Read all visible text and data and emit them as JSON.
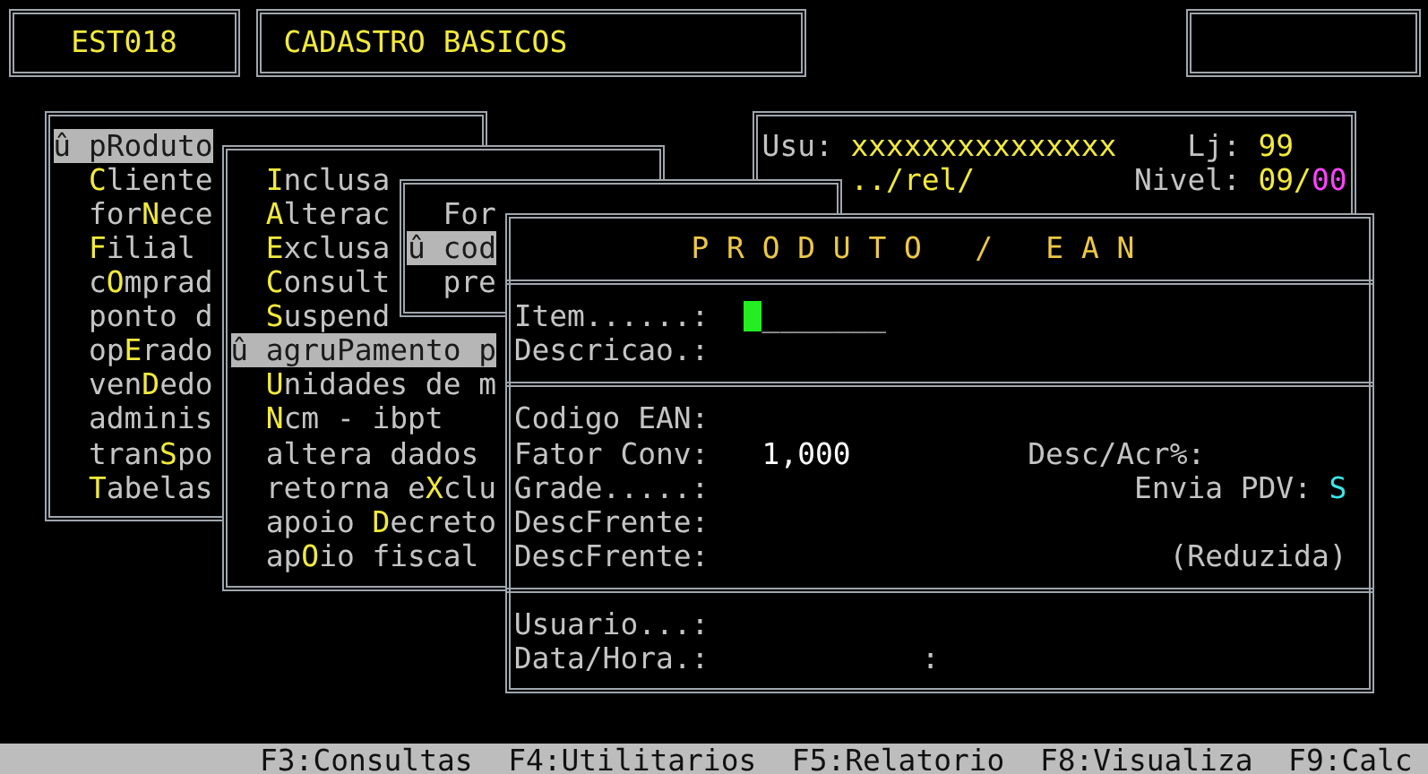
{
  "header": {
    "program_code": "EST018",
    "title": "CADASTRO BASICOS"
  },
  "main_menu": {
    "items": [
      {
        "label": "û p**R**oduto",
        "selected": true
      },
      {
        "label": "**C**liente",
        "selected": false
      },
      {
        "label": "for**N**ece",
        "selected": false
      },
      {
        "label": "**F**ilial",
        "selected": false
      },
      {
        "label": "c**O**mprad",
        "selected": false
      },
      {
        "label": "ponto d",
        "selected": false
      },
      {
        "label": "op**E**rado",
        "selected": false
      },
      {
        "label": "ven**D**edo",
        "selected": false
      },
      {
        "label": "adminis",
        "selected": false
      },
      {
        "label": "tran**S**po",
        "selected": false
      },
      {
        "label": "**T**abelas",
        "selected": false
      }
    ]
  },
  "submenu": {
    "items": [
      {
        "label": "**I**nclusa",
        "selected": false
      },
      {
        "label": "**A**lterac",
        "selected": false
      },
      {
        "label": "**E**xclusa",
        "selected": false
      },
      {
        "label": "**C**onsult",
        "selected": false
      },
      {
        "label": "**S**uspend",
        "selected": false
      },
      {
        "label": "û agru**P**amento p",
        "selected": true
      },
      {
        "label": "**U**nidades de m",
        "selected": false
      },
      {
        "label": "**N**cm - ibpt",
        "selected": false
      },
      {
        "label": "altera dados",
        "selected": false
      },
      {
        "label": "retorna e**X**clu",
        "selected": false
      },
      {
        "label": "apoio **D**ecreto",
        "selected": false
      },
      {
        "label": "ap**O**io fiscal",
        "selected": false
      }
    ]
  },
  "submenu_2": {
    "items": [
      {
        "label": "For",
        "selected": false
      },
      {
        "label": "û cod",
        "selected": true
      },
      {
        "label": "pre",
        "selected": false
      }
    ]
  },
  "session": {
    "user_label": "Usu:",
    "user": "xxxxxxxxxxxxxxx",
    "store_label": "Lj:",
    "store": "99",
    "path": "../rel/",
    "level_label": "Nivel:",
    "level": "09/**00**"
  },
  "product_window": {
    "title": "P R O D U T O   /   E A N",
    "item": {
      "label": "Item......:",
      "value": "_______",
      "focused": true
    },
    "description": {
      "label": "Descricao.:"
    },
    "ean_code": {
      "label": "Codigo EAN:"
    },
    "conversion_factor": {
      "label": "Fator Conv:",
      "value": "1,000"
    },
    "discount": {
      "label": "Desc/Acr%:"
    },
    "grade": {
      "label": "Grade.....:"
    },
    "send_to_pdv": {
      "label": "Envia PDV:",
      "value": "S"
    },
    "front_description": {
      "label": "DescFrente:"
    },
    "front_description_short": {
      "label": "DescFrente:",
      "note": "(Reduzida)"
    },
    "user": {
      "label": "Usuario...:"
    },
    "date_time": {
      "label": "Data/Hora.:",
      "separator": ":"
    }
  },
  "status_bar": {
    "items": [
      "F3:Consultas",
      "F4:Utilitarios",
      "F5:Relatorio",
      "F8:Visualiza",
      "F9:Calc"
    ]
  }
}
